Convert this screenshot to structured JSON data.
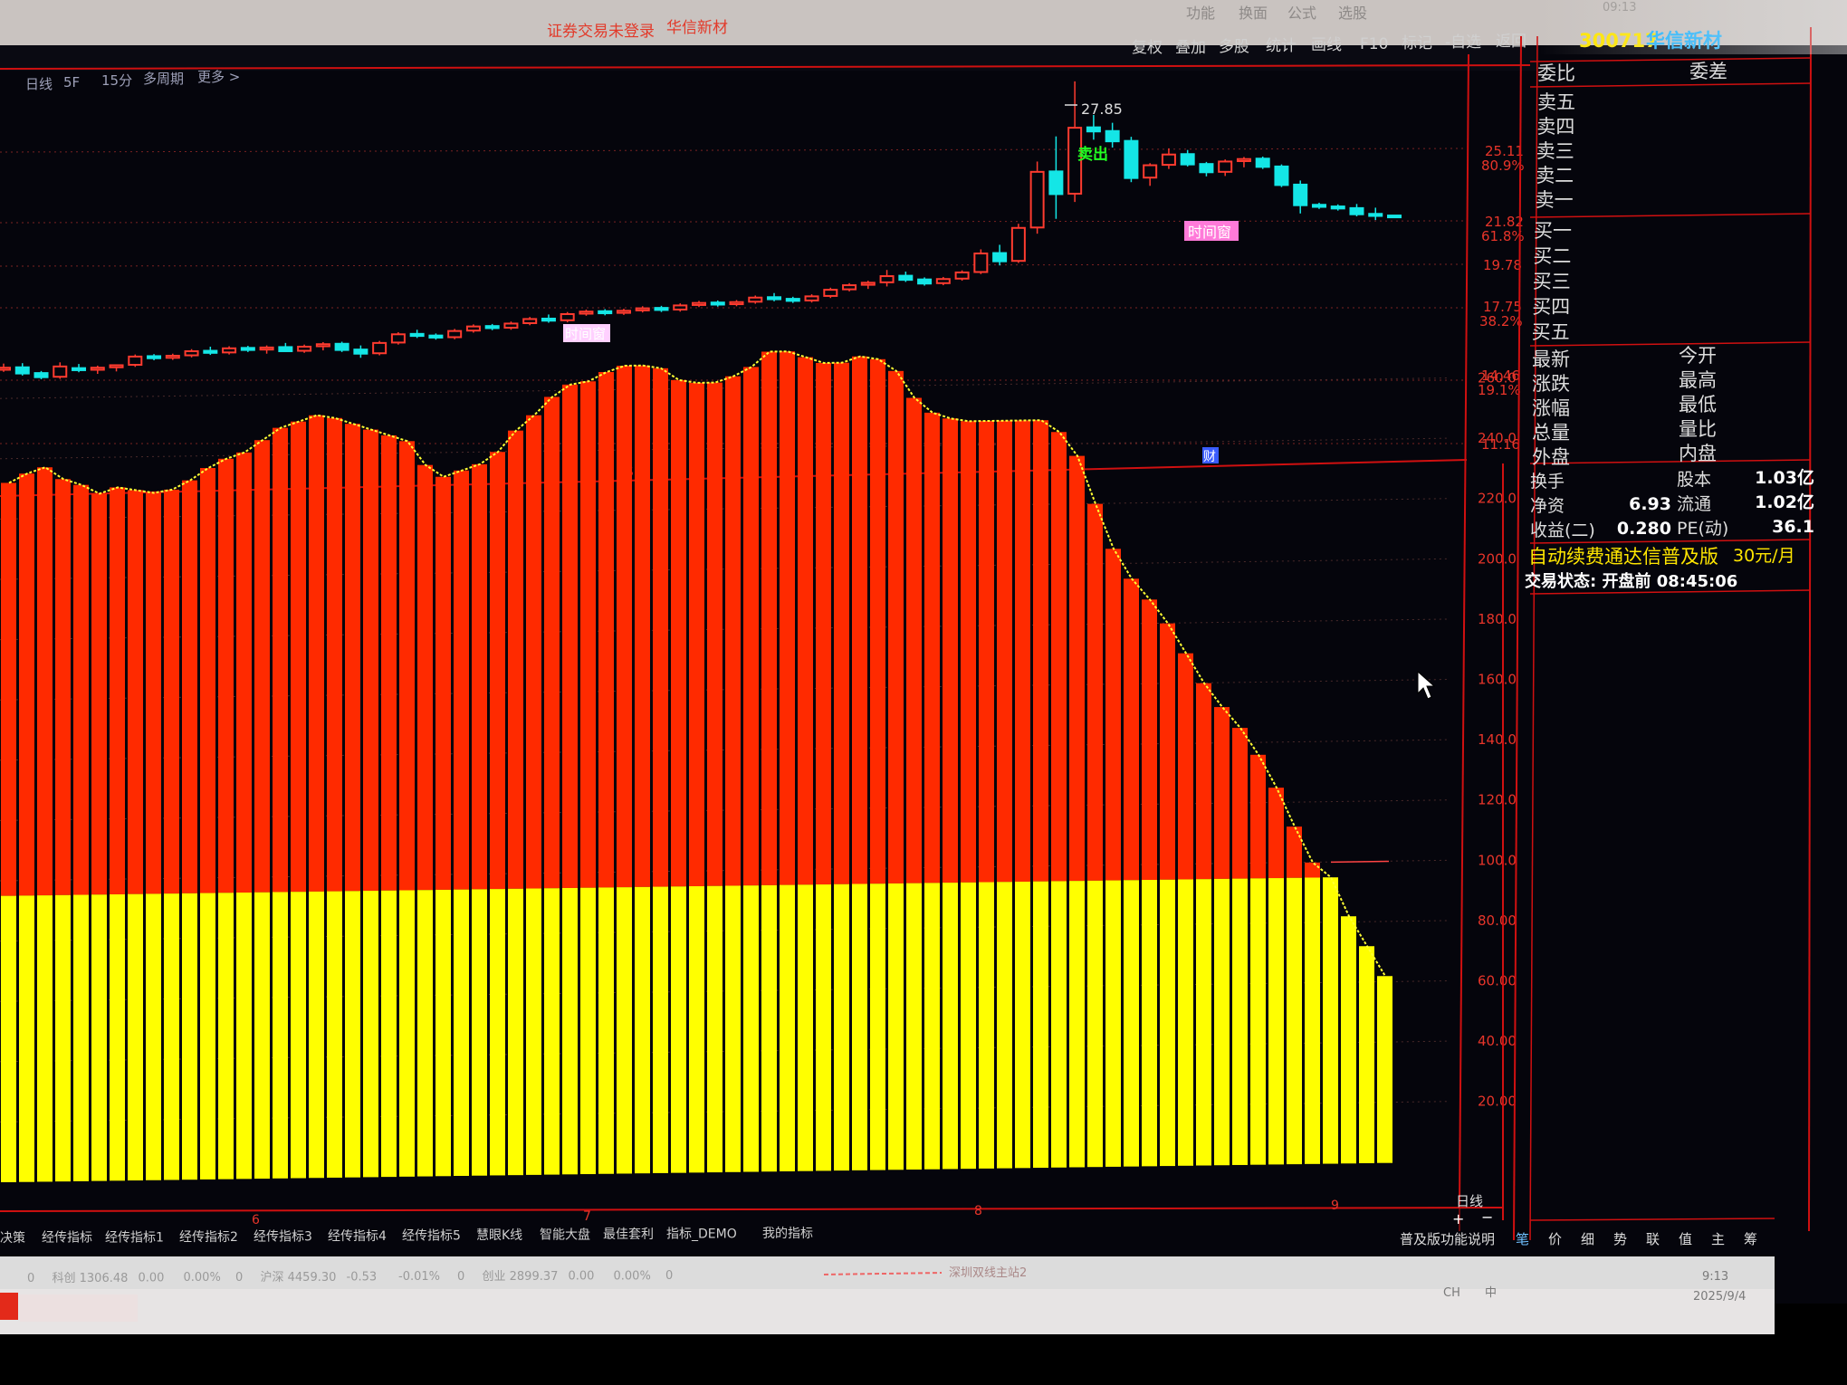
{
  "window": {
    "title_left": "证券交易未登录",
    "title_right": "华信新材",
    "top_menu": [
      "功能",
      "换面",
      "公式",
      "选股"
    ],
    "clock": "09:13"
  },
  "toolbar": {
    "period_tabs": [
      "日线",
      "5F",
      "15分",
      "多周期",
      "更多 >"
    ],
    "buttons": [
      "复权",
      "叠加",
      "多股",
      "统计",
      "画线",
      "F10",
      "标记",
      "-自选",
      "返回"
    ]
  },
  "stock": {
    "code": "300717",
    "name": "华信新材"
  },
  "main_chart": {
    "peak_label": "27.85",
    "sell_marker": "卖出",
    "time_window_label": "时间窗",
    "finance_marker": "财",
    "dividend_marker": "$",
    "price_axis": [
      {
        "value": "25.11",
        "pct": "80.9%"
      },
      {
        "value": "21.82",
        "pct": "61.8%"
      },
      {
        "value": "19.78",
        "pct": ""
      },
      {
        "value": "17.75",
        "pct": "38.2%"
      },
      {
        "value": "14.46",
        "pct": "19.1%"
      },
      {
        "value": "11.16",
        "pct": ""
      }
    ]
  },
  "indicator_chart": {
    "axis": [
      "260.0",
      "240.0",
      "220.0",
      "200.0",
      "180.0",
      "160.0",
      "140.0",
      "120.0",
      "100.0",
      "80.00",
      "60.00",
      "40.00",
      "20.00"
    ],
    "period_label": "日线",
    "month_markers": [
      "6",
      "7",
      "8",
      "9"
    ],
    "colors": {
      "upper": "#ff2a00",
      "lower": "#ffff00",
      "line": "#ffff33"
    }
  },
  "chart_data": {
    "type": "bar",
    "title": "",
    "description_series": [
      "upper",
      "lower"
    ],
    "y_range": [
      0,
      260
    ],
    "values": [
      232,
      235,
      237,
      233,
      231,
      228,
      230,
      229,
      228,
      229,
      232,
      236,
      239,
      241,
      245,
      249,
      251,
      253,
      252,
      250,
      248,
      246,
      244,
      236,
      232,
      234,
      236,
      240,
      247,
      252,
      258,
      262,
      263,
      266,
      268,
      268,
      267,
      263,
      262,
      262,
      264,
      267,
      272,
      272,
      270,
      268,
      268,
      270,
      269,
      265,
      256,
      251,
      249,
      248,
      248,
      248,
      248,
      248,
      244,
      236,
      220,
      205,
      195,
      188,
      180,
      170,
      160,
      152,
      145,
      136,
      125,
      112,
      100,
      95,
      82,
      72,
      62
    ],
    "lower_values": [
      95,
      95,
      95,
      95,
      95,
      95,
      95,
      95,
      95,
      95,
      95,
      95,
      95,
      95,
      95,
      95,
      95,
      95,
      95,
      95,
      95,
      95,
      95,
      95,
      95,
      95,
      95,
      95,
      95,
      95,
      95,
      95,
      95,
      95,
      95,
      95,
      95,
      95,
      95,
      95,
      95,
      95,
      95,
      95,
      95,
      95,
      95,
      95,
      95,
      95,
      95,
      95,
      95,
      95,
      95,
      95,
      95,
      95,
      95,
      95,
      95,
      95,
      95,
      95,
      95,
      95,
      95,
      95,
      95,
      95,
      95,
      95,
      95,
      95,
      82,
      72,
      62
    ]
  },
  "candles": {
    "up_color": "#ff3b2f",
    "down_color": "#14e6e6",
    "data": [
      [
        15.0,
        15.3,
        14.9,
        15.1
      ],
      [
        15.1,
        15.3,
        14.7,
        14.8
      ],
      [
        14.8,
        14.9,
        14.5,
        14.6
      ],
      [
        14.6,
        15.3,
        14.5,
        15.1
      ],
      [
        15.0,
        15.2,
        14.8,
        14.9
      ],
      [
        14.9,
        15.1,
        14.7,
        15.0
      ],
      [
        15.0,
        15.1,
        14.8,
        15.1
      ],
      [
        15.1,
        15.6,
        15.0,
        15.5
      ],
      [
        15.5,
        15.6,
        15.3,
        15.4
      ],
      [
        15.4,
        15.6,
        15.3,
        15.5
      ],
      [
        15.5,
        15.8,
        15.4,
        15.7
      ],
      [
        15.7,
        15.9,
        15.5,
        15.6
      ],
      [
        15.6,
        15.9,
        15.5,
        15.8
      ],
      [
        15.8,
        15.9,
        15.6,
        15.7
      ],
      [
        15.7,
        15.9,
        15.5,
        15.8
      ],
      [
        15.8,
        16.0,
        15.6,
        15.6
      ],
      [
        15.6,
        15.9,
        15.5,
        15.8
      ],
      [
        15.8,
        16.0,
        15.6,
        15.9
      ],
      [
        15.9,
        16.0,
        15.5,
        15.6
      ],
      [
        15.6,
        15.8,
        15.2,
        15.4
      ],
      [
        15.4,
        16.0,
        15.3,
        15.9
      ],
      [
        15.9,
        16.4,
        15.8,
        16.3
      ],
      [
        16.3,
        16.5,
        16.1,
        16.2
      ],
      [
        16.2,
        16.3,
        16.0,
        16.1
      ],
      [
        16.1,
        16.5,
        16.0,
        16.4
      ],
      [
        16.4,
        16.7,
        16.3,
        16.6
      ],
      [
        16.6,
        16.7,
        16.4,
        16.5
      ],
      [
        16.5,
        16.8,
        16.4,
        16.7
      ],
      [
        16.7,
        17.0,
        16.6,
        16.9
      ],
      [
        16.9,
        17.1,
        16.7,
        16.8
      ],
      [
        16.8,
        17.2,
        16.7,
        17.1
      ],
      [
        17.1,
        17.3,
        17.0,
        17.2
      ],
      [
        17.2,
        17.3,
        17.0,
        17.1
      ],
      [
        17.1,
        17.3,
        17.0,
        17.2
      ],
      [
        17.2,
        17.4,
        17.1,
        17.3
      ],
      [
        17.3,
        17.4,
        17.1,
        17.2
      ],
      [
        17.2,
        17.5,
        17.1,
        17.4
      ],
      [
        17.4,
        17.6,
        17.3,
        17.5
      ],
      [
        17.5,
        17.6,
        17.3,
        17.4
      ],
      [
        17.4,
        17.6,
        17.3,
        17.5
      ],
      [
        17.5,
        17.8,
        17.4,
        17.7
      ],
      [
        17.7,
        17.9,
        17.5,
        17.6
      ],
      [
        17.6,
        17.7,
        17.4,
        17.5
      ],
      [
        17.5,
        17.8,
        17.4,
        17.7
      ],
      [
        17.7,
        18.1,
        17.6,
        18.0
      ],
      [
        18.0,
        18.3,
        17.9,
        18.2
      ],
      [
        18.2,
        18.4,
        18.0,
        18.3
      ],
      [
        18.3,
        18.9,
        18.1,
        18.6
      ],
      [
        18.6,
        18.8,
        18.3,
        18.4
      ],
      [
        18.4,
        18.5,
        18.1,
        18.2
      ],
      [
        18.2,
        18.5,
        18.1,
        18.4
      ],
      [
        18.4,
        18.8,
        18.3,
        18.7
      ],
      [
        18.7,
        19.8,
        18.6,
        19.6
      ],
      [
        19.6,
        20.0,
        19.0,
        19.2
      ],
      [
        19.2,
        21.0,
        19.1,
        20.8
      ],
      [
        20.8,
        24.0,
        20.5,
        23.5
      ],
      [
        23.5,
        25.2,
        21.2,
        22.4
      ],
      [
        22.4,
        27.85,
        22.0,
        25.6
      ],
      [
        25.6,
        26.2,
        25.0,
        25.4
      ],
      [
        25.4,
        25.8,
        24.6,
        24.9
      ],
      [
        24.9,
        25.1,
        22.9,
        23.1
      ],
      [
        23.1,
        23.8,
        22.7,
        23.7
      ],
      [
        23.7,
        24.5,
        23.5,
        24.2
      ],
      [
        24.2,
        24.4,
        23.6,
        23.7
      ],
      [
        23.7,
        23.8,
        23.1,
        23.3
      ],
      [
        23.3,
        23.9,
        23.1,
        23.8
      ],
      [
        23.8,
        24.0,
        23.5,
        23.9
      ],
      [
        23.9,
        24.0,
        23.4,
        23.5
      ],
      [
        23.5,
        23.6,
        22.5,
        22.6
      ],
      [
        22.6,
        22.8,
        21.2,
        21.6
      ],
      [
        21.6,
        21.7,
        21.4,
        21.5
      ],
      [
        21.5,
        21.6,
        21.3,
        21.4
      ],
      [
        21.4,
        21.6,
        21.0,
        21.1
      ],
      [
        21.1,
        21.4,
        20.8,
        21.0
      ],
      [
        21.0,
        21.0,
        20.9,
        20.95
      ]
    ]
  },
  "quote_panel": {
    "header": [
      "委比",
      "委差"
    ],
    "sell_rows": [
      "卖五",
      "卖四",
      "卖三",
      "卖二",
      "卖一"
    ],
    "buy_rows": [
      "买一",
      "买二",
      "买三",
      "买四",
      "买五"
    ],
    "stats_left": [
      "最新",
      "涨跌",
      "涨幅",
      "总量",
      "外盘"
    ],
    "stats_right": [
      "今开",
      "最高",
      "最低",
      "量比",
      "内盘"
    ],
    "info": [
      {
        "l1": "换手",
        "v1": "",
        "l2": "股本",
        "v2": "1.03亿"
      },
      {
        "l1": "净资",
        "v1": "6.93",
        "l2": "流通",
        "v2": "1.02亿"
      },
      {
        "l1": "收益(二)",
        "v1": "0.280",
        "l2": "PE(动)",
        "v2": "36.1"
      }
    ],
    "promo": "自动续费通达信普及版",
    "price": "30元/月",
    "status_label": "交易状态: 开盘前 08:45:06",
    "bottom_tabs": [
      "普及版功能说明",
      "笔",
      "价",
      "细",
      "势",
      "联",
      "值",
      "主",
      "筹"
    ]
  },
  "indicator_tabs": [
    "决策",
    "经传指标",
    "经传指标1",
    "经传指标2",
    "经传指标3",
    "经传指标4",
    "经传指标5",
    "慧眼K线",
    "智能大盘",
    "最佳套利",
    "指标_DEMO",
    "我的指标"
  ],
  "status_bar": {
    "items": [
      "0",
      "科创 1306.48",
      "0.00",
      "0.00%",
      "0",
      "沪深 4459.30",
      "-0.53",
      "-0.01%",
      "0",
      "创业 2899.37",
      "0.00",
      "0.00%",
      "0"
    ],
    "scroll_text": "深圳双线主站2",
    "tray": [
      "CH",
      "中",
      "9:13",
      "2025/9/4"
    ]
  }
}
